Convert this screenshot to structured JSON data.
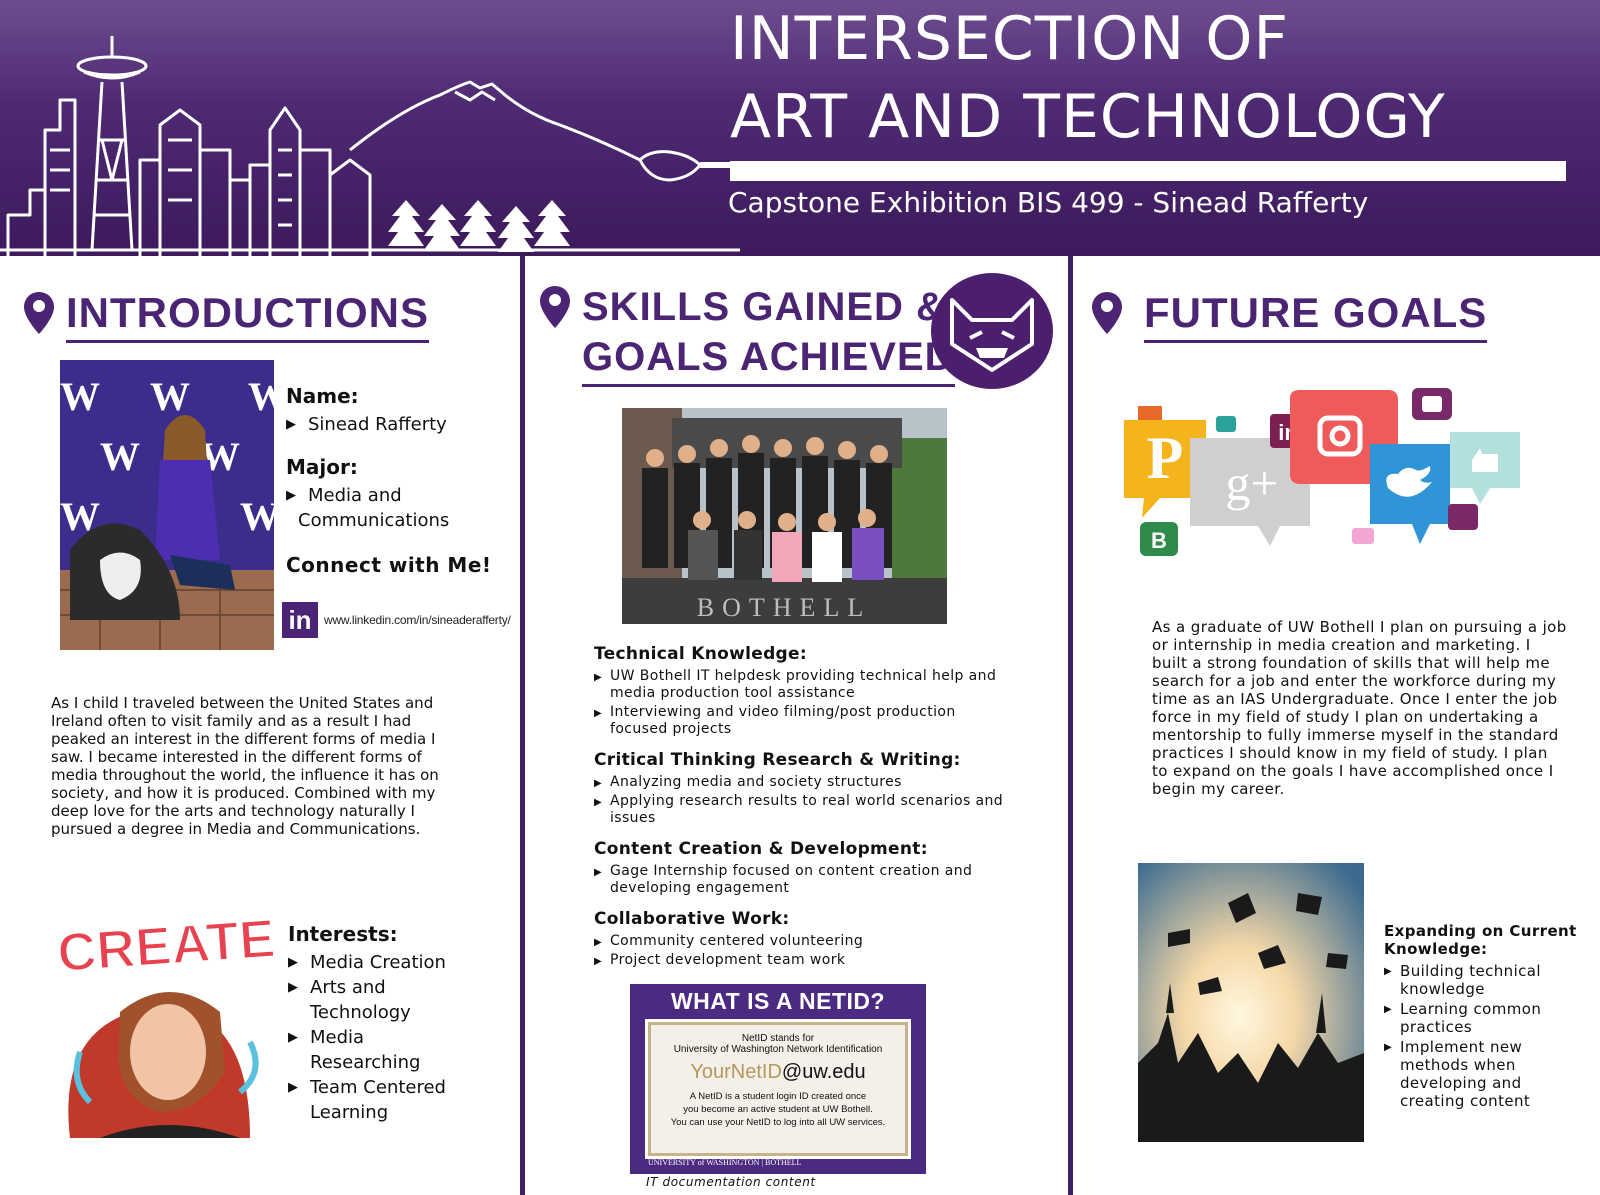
{
  "header": {
    "title_line1": "INTERSECTION OF",
    "title_line2": "ART AND TECHNOLOGY",
    "subtitle": "Capstone Exhibition BIS 499 - Sinead Rafferty"
  },
  "introductions": {
    "heading": "INTRODUCTIONS",
    "name_label": "Name:",
    "name_value": "Sinead Rafferty",
    "major_label": "Major:",
    "major_value_line1": "Media and",
    "major_value_line2": "Communications",
    "connect_label": "Connect with Me!",
    "linkedin_url": "www.linkedin.com/in/sineaderafferty/",
    "linkedin_icon_text": "in",
    "bio": "As I child I traveled between the United States and Ireland often to visit family and as a result I had peaked an interest in the different forms of media I saw. I became interested in the different forms of media throughout the world, the influence it has on society, and how it is produced. Combined with my deep love for the arts and technology naturally I pursued a degree in Media and Communications.",
    "interests_label": "Interests:",
    "interests": [
      "Media Creation",
      "Arts and Technology",
      "Media Researching",
      "Team Centered Learning"
    ],
    "create_art_text": "CREATE"
  },
  "skills": {
    "heading_line1": "SKILLS GAINED &",
    "heading_line2": "GOALS ACHIEVED",
    "categories": [
      {
        "label": "Technical Knowledge:",
        "items": [
          "UW Bothell IT helpdesk providing technical help and media production tool assistance",
          "Interviewing and video filming/post production focused projects"
        ]
      },
      {
        "label": "Critical Thinking Research & Writing:",
        "items": [
          "Analyzing media and society structures",
          "Applying research results to real world scenarios and issues"
        ]
      },
      {
        "label": "Content Creation & Development:",
        "items": [
          "Gage Internship focused on content creation and developing engagement"
        ]
      },
      {
        "label": "Collaborative Work:",
        "items": [
          "Community centered volunteering",
          "Project development team work"
        ]
      }
    ],
    "group_photo_sign_text": "BOTHELL",
    "netid": {
      "title": "WHAT IS A NETID?",
      "line1": "NetID stands for",
      "line2": "University of Washington Network Identification",
      "example_user": "YourNetID",
      "example_domain": "@uw.edu",
      "desc_line1": "A NetID is a student login ID created once",
      "desc_line2": "you become an active student at UW Bothell.",
      "desc_line3": "You can use your NetID to log into all UW services.",
      "footer": "UNIVERSITY of WASHINGTON | BOTHELL",
      "caption": "IT documentation content"
    }
  },
  "future": {
    "heading": "FUTURE GOALS",
    "paragraph": "As a graduate of UW Bothell I plan on pursuing a job or internship in media creation and marketing. I built a strong foundation of skills that will help me search for a job and enter the workforce during my time as an IAS Undergraduate. Once I enter the job force in my field of study I plan on undertaking a mentorship to fully immerse myself in the standard practices I should know in my field of study. I plan to expand on the goals I have accomplished once I begin my career.",
    "expanding_label": "Expanding on Current Knowledge:",
    "expanding_items": [
      "Building technical knowledge",
      "Learning common practices",
      "Implement new methods when developing and creating content"
    ],
    "social_icons": [
      "pinterest-icon",
      "google-plus-icon",
      "linkedin-icon",
      "instagram-icon",
      "twitter-icon",
      "youtube-icon",
      "like-icon",
      "blogger-icon"
    ]
  },
  "colors": {
    "purple": "#4b2573",
    "header_dark": "#3c1a5c",
    "gold": "#b6985b"
  }
}
